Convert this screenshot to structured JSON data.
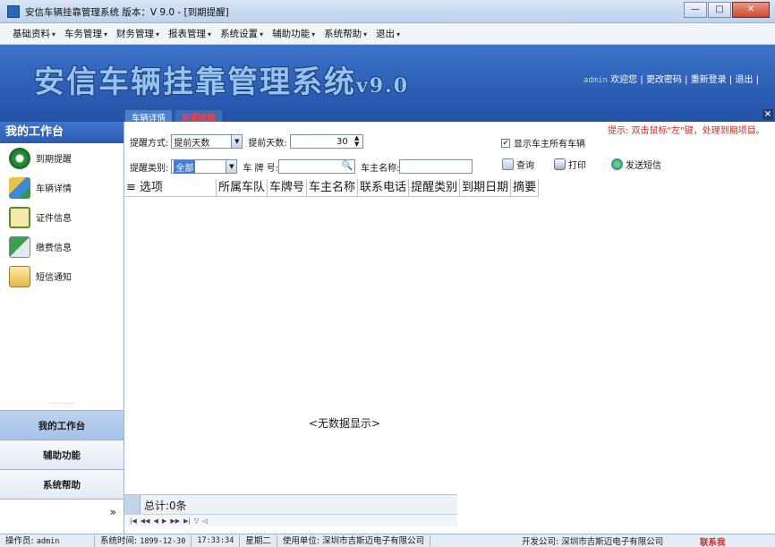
{
  "window": {
    "title": "安信车辆挂靠管理系统 版本：V 9.0 - [到期提醒]",
    "controls": {
      "minimize": "—",
      "maximize": "□",
      "close": "✕"
    }
  },
  "menu": [
    {
      "label": "基础资料",
      "arrow": "▾"
    },
    {
      "label": "车务管理",
      "arrow": "▾"
    },
    {
      "label": "财务管理",
      "arrow": "▾"
    },
    {
      "label": "报表管理",
      "arrow": "▾"
    },
    {
      "label": "系统设置",
      "arrow": "▾"
    },
    {
      "label": "辅助功能",
      "arrow": "▾"
    },
    {
      "label": "系统帮助",
      "arrow": "▾"
    },
    {
      "label": "退出",
      "arrow": "▾"
    }
  ],
  "banner": {
    "logo": "安信车辆挂靠管理系统",
    "version": "v9.0",
    "username": "admin",
    "welcome": "欢迎您",
    "change_password": "更改密码",
    "relogin": "重新登录",
    "logout": "退出",
    "sep": "|"
  },
  "tabs": [
    {
      "label": "车辆详情",
      "active": false
    },
    {
      "label": "到期提醒",
      "active": true
    }
  ],
  "close_panel": "×",
  "sidebar": {
    "title": "我的工作台",
    "items": [
      {
        "label": "到期提醒",
        "icon": "clock-icon"
      },
      {
        "label": "车辆详情",
        "icon": "vehicle-icon"
      },
      {
        "label": "证件信息",
        "icon": "certificate-icon"
      },
      {
        "label": "缴费信息",
        "icon": "payment-icon"
      },
      {
        "label": "短信通知",
        "icon": "sms-icon"
      }
    ],
    "divider": "··········",
    "nav": [
      {
        "label": "我的工作台",
        "active": true
      },
      {
        "label": "辅助功能",
        "active": false
      },
      {
        "label": "系统帮助",
        "active": false
      }
    ],
    "expander": "»"
  },
  "filters": {
    "mode_label": "提醒方式:",
    "mode_value": "提前天数",
    "days_label": "提前天数:",
    "days_value": "30",
    "type_label": "提醒类别:",
    "type_value": "全部",
    "plate_label": "车 牌 号:",
    "plate_value": "",
    "owner_label": "车主名称:",
    "owner_value": "",
    "show_all_label": "显示车主所有车辆",
    "show_all_checked": true,
    "hint": "提示: 双击鼠标\"左\"键，处理到期项目。"
  },
  "actions": {
    "query": "查询",
    "print": "打印",
    "send_sms": "发送短信"
  },
  "grid": {
    "columns": [
      "≡ 选项",
      "所属车队",
      "车牌号",
      "车主名称",
      "联系电话",
      "提醒类别",
      "到期日期",
      "摘要"
    ],
    "empty_text": "<无数据显示>",
    "total": "总计:0条",
    "pager": [
      "|◀",
      "◀◀",
      "◀",
      "▶",
      "▶▶",
      "▶|",
      "▽",
      "◁"
    ]
  },
  "statusbar": {
    "operator_label": "操作员:",
    "operator": "admin",
    "systime_label": "系统时间:",
    "date": "1899-12-30",
    "time": "17:33:34",
    "weekday": "星期二",
    "unit_label": "使用单位:",
    "unit": "深圳市吉斯迈电子有限公司",
    "marquee": "开发公司: 深圳市吉斯迈电子有限公司",
    "marquee_badge": "联系我"
  },
  "colors": {
    "banner": "#2a5ab1",
    "accent_red": "#e0241b",
    "logo": "#93c3ee"
  }
}
